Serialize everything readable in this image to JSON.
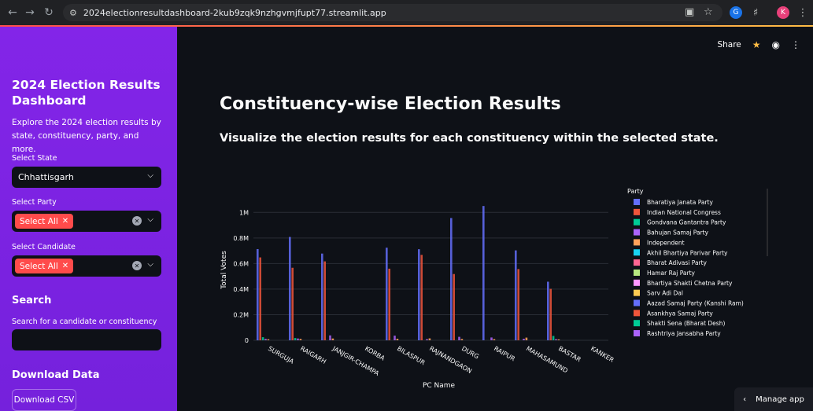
{
  "browser": {
    "url": "2024electionresultdashboard-2kub9zqk9nzhgvmjfupt77.streamlit.app",
    "profile_initial": "K",
    "extension_initial": "G"
  },
  "sidebar": {
    "title": "2024 Election Results Dashboard",
    "description": "Explore the 2024 election results by state, constituency, party, and more.",
    "state_label": "Select State",
    "state_value": "Chhattisgarh",
    "party_label": "Select Party",
    "party_tag": "Select All",
    "candidate_label": "Select Candidate",
    "candidate_tag": "Select All",
    "search_heading": "Search",
    "search_label": "Search for a candidate or constituency",
    "search_value": "",
    "download_heading": "Download Data",
    "download_button": "Download CSV"
  },
  "toolbar": {
    "share": "Share",
    "manage_app": "Manage app"
  },
  "main": {
    "title": "Constituency-wise Election Results",
    "subtitle": "Visualize the election results for each constituency within the selected state."
  },
  "chart_data": {
    "type": "bar",
    "xlabel": "PC Name",
    "ylabel": "Total Votes",
    "ylim": [
      0,
      1100000
    ],
    "y_ticks": [
      0,
      200000,
      400000,
      600000,
      800000,
      1000000
    ],
    "y_tick_labels": [
      "0",
      "0.2M",
      "0.4M",
      "0.6M",
      "0.8M",
      "1M"
    ],
    "legend_title": "Party",
    "legend_position": "right",
    "categories": [
      "SURGUJA",
      "RAIGARH",
      "JANJGIR-CHAMPA",
      "KORBA",
      "BILASPUR",
      "RAJNANDGAON",
      "DURG",
      "RAIPUR",
      "MAHASAMUND",
      "BASTAR",
      "KANKER"
    ],
    "series": [
      {
        "name": "Bharatiya Janata Party",
        "color": "#636efa",
        "values": [
          713000,
          808000,
          678000,
          0,
          724000,
          712000,
          956000,
          1050000,
          703000,
          458000,
          0
        ]
      },
      {
        "name": "Indian National Congress",
        "color": "#ef553b",
        "values": [
          648000,
          567000,
          617000,
          0,
          560000,
          668000,
          518000,
          0,
          557000,
          402000,
          0
        ]
      },
      {
        "name": "Gondvana Gantantra Party",
        "color": "#00cc96",
        "values": [
          24000,
          18000,
          0,
          0,
          0,
          0,
          0,
          0,
          0,
          34000,
          0
        ]
      },
      {
        "name": "Bahujan Samaj Party",
        "color": "#ab63fa",
        "values": [
          11000,
          14000,
          38000,
          0,
          36000,
          9000,
          27000,
          22000,
          12000,
          9000,
          0
        ]
      },
      {
        "name": "Independent",
        "color": "#ffa15a",
        "values": [
          8000,
          11000,
          14000,
          0,
          12000,
          15000,
          10000,
          9000,
          21000,
          7000,
          0
        ]
      },
      {
        "name": "Akhil Bhartiya Parivar Party",
        "color": "#19d3f3",
        "values": [
          0,
          0,
          0,
          0,
          0,
          0,
          0,
          0,
          0,
          0,
          0
        ]
      },
      {
        "name": "Bharat Adivasi Party",
        "color": "#ff6692",
        "values": [
          0,
          0,
          0,
          0,
          0,
          0,
          0,
          0,
          0,
          0,
          0
        ]
      },
      {
        "name": "Hamar Raj Party",
        "color": "#b6e880",
        "values": [
          0,
          0,
          0,
          0,
          0,
          0,
          0,
          0,
          0,
          0,
          0
        ]
      },
      {
        "name": "Bhartiya Shakti Chetna Party",
        "color": "#ff97ff",
        "values": [
          0,
          0,
          0,
          0,
          0,
          0,
          0,
          0,
          0,
          0,
          0
        ]
      },
      {
        "name": "Sarv Adi Dal",
        "color": "#fecb52",
        "values": [
          0,
          0,
          0,
          0,
          0,
          0,
          0,
          0,
          0,
          0,
          0
        ]
      },
      {
        "name": "Aazad Samaj Party (Kanshi Ram)",
        "color": "#636efa",
        "values": [
          0,
          0,
          0,
          0,
          0,
          0,
          0,
          0,
          0,
          0,
          0
        ]
      },
      {
        "name": "Asankhya Samaj Party",
        "color": "#ef553b",
        "values": [
          0,
          0,
          0,
          0,
          0,
          0,
          0,
          0,
          0,
          0,
          0
        ]
      },
      {
        "name": "Shakti Sena (Bharat Desh)",
        "color": "#00cc96",
        "values": [
          0,
          0,
          0,
          0,
          0,
          0,
          0,
          0,
          0,
          0,
          0
        ]
      },
      {
        "name": "Rashtriya Jansabha Party",
        "color": "#ab63fa",
        "values": [
          0,
          0,
          0,
          0,
          0,
          0,
          0,
          0,
          0,
          0,
          0
        ]
      }
    ],
    "legend_visible_count": 14,
    "grid": true
  }
}
